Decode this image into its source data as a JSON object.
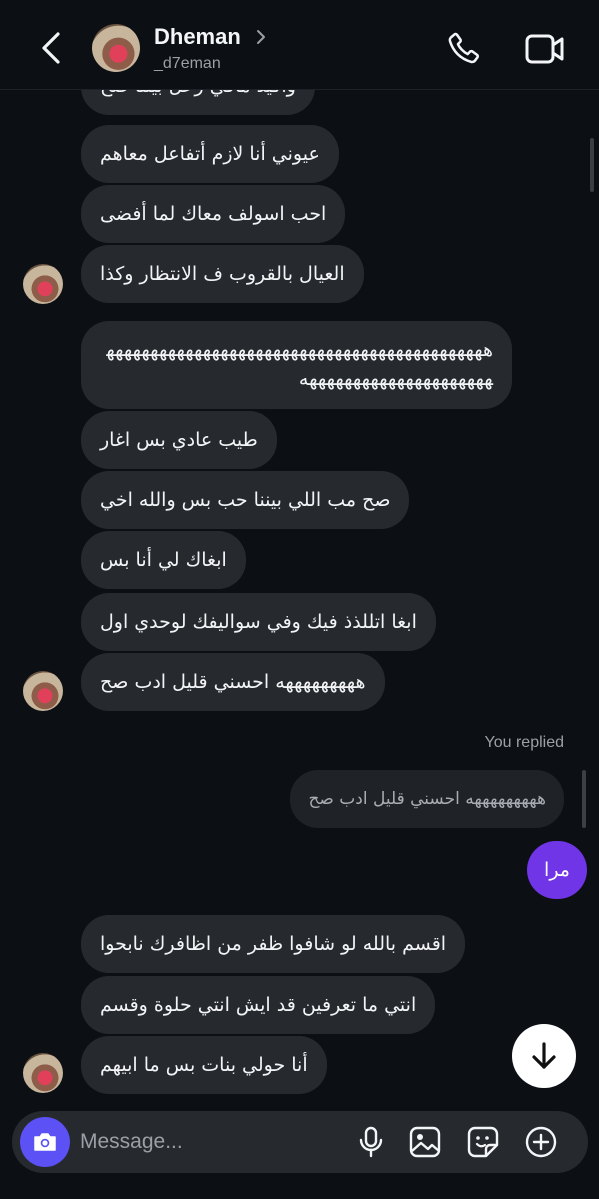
{
  "header": {
    "name": "Dheman",
    "username": "_d7eman"
  },
  "messages": {
    "m0": "واكيد مافي زعل بيننا صح",
    "m1": "عيوني أنا لازم أتفاعل معاهم",
    "m2": "احب اسولف معاك لما أفضى",
    "m3": "العيال بالقروب ف الانتظار وكذا",
    "m4": "هههههههههههههههههههههههههههههههههههههههههههههههههههههههههههههههههه",
    "m5": "طيب عادي بس اغار",
    "m6": "صح مب اللي بيننا حب بس والله اخي",
    "m7": "ابغاك لي أنا بس",
    "m8": "ابغا اتللذذ فيك وفي سواليفك لوحدي اول",
    "m9": "هههههههههه احسني قليل ادب صح",
    "m10": "اقسم بالله لو شافوا ظفر من اظافرك نابحوا",
    "m11": "انتي ما تعرفين قد ايش انتي حلوة وقسم",
    "m12": "أنا حولي بنات بس ما ابيهم"
  },
  "reply": {
    "label": "You replied",
    "quoted": "هههههههههه احسني قليل ادب صح",
    "sent": "مرا"
  },
  "composer": {
    "placeholder": "Message..."
  },
  "icons": {
    "back": "chevron-left-icon",
    "call": "phone-icon",
    "video": "video-camera-icon",
    "camera": "camera-icon",
    "mic": "microphone-icon",
    "gallery": "image-icon",
    "sticker": "sticker-icon",
    "plus": "plus-circle-icon",
    "scroll": "arrow-down-icon"
  },
  "colors": {
    "background": "#0c1015",
    "received_bubble": "#262a2f",
    "sent_bubble": "#6f35e6",
    "camera_button": "#5b51f5"
  }
}
